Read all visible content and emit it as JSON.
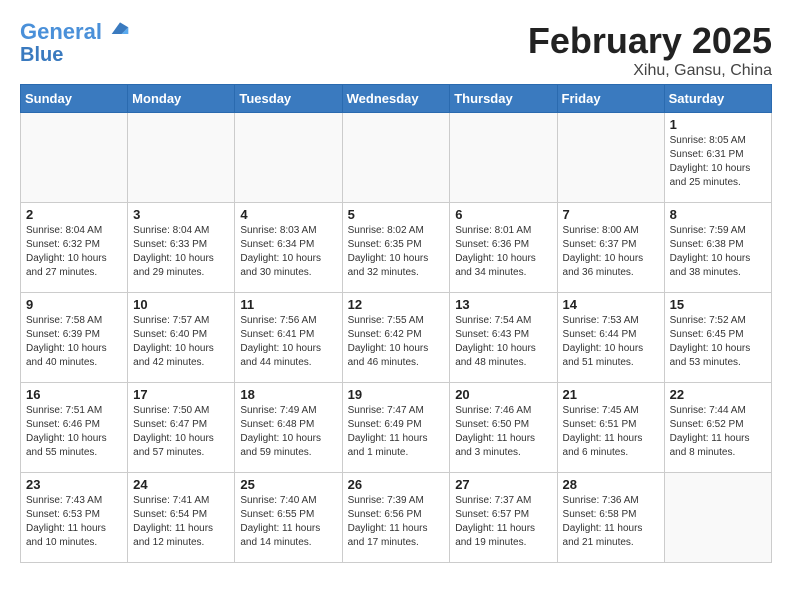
{
  "header": {
    "logo_line1": "General",
    "logo_line2": "Blue",
    "month": "February 2025",
    "location": "Xihu, Gansu, China"
  },
  "weekdays": [
    "Sunday",
    "Monday",
    "Tuesday",
    "Wednesday",
    "Thursday",
    "Friday",
    "Saturday"
  ],
  "weeks": [
    [
      {
        "day": "",
        "info": ""
      },
      {
        "day": "",
        "info": ""
      },
      {
        "day": "",
        "info": ""
      },
      {
        "day": "",
        "info": ""
      },
      {
        "day": "",
        "info": ""
      },
      {
        "day": "",
        "info": ""
      },
      {
        "day": "1",
        "info": "Sunrise: 8:05 AM\nSunset: 6:31 PM\nDaylight: 10 hours\nand 25 minutes."
      }
    ],
    [
      {
        "day": "2",
        "info": "Sunrise: 8:04 AM\nSunset: 6:32 PM\nDaylight: 10 hours\nand 27 minutes."
      },
      {
        "day": "3",
        "info": "Sunrise: 8:04 AM\nSunset: 6:33 PM\nDaylight: 10 hours\nand 29 minutes."
      },
      {
        "day": "4",
        "info": "Sunrise: 8:03 AM\nSunset: 6:34 PM\nDaylight: 10 hours\nand 30 minutes."
      },
      {
        "day": "5",
        "info": "Sunrise: 8:02 AM\nSunset: 6:35 PM\nDaylight: 10 hours\nand 32 minutes."
      },
      {
        "day": "6",
        "info": "Sunrise: 8:01 AM\nSunset: 6:36 PM\nDaylight: 10 hours\nand 34 minutes."
      },
      {
        "day": "7",
        "info": "Sunrise: 8:00 AM\nSunset: 6:37 PM\nDaylight: 10 hours\nand 36 minutes."
      },
      {
        "day": "8",
        "info": "Sunrise: 7:59 AM\nSunset: 6:38 PM\nDaylight: 10 hours\nand 38 minutes."
      }
    ],
    [
      {
        "day": "9",
        "info": "Sunrise: 7:58 AM\nSunset: 6:39 PM\nDaylight: 10 hours\nand 40 minutes."
      },
      {
        "day": "10",
        "info": "Sunrise: 7:57 AM\nSunset: 6:40 PM\nDaylight: 10 hours\nand 42 minutes."
      },
      {
        "day": "11",
        "info": "Sunrise: 7:56 AM\nSunset: 6:41 PM\nDaylight: 10 hours\nand 44 minutes."
      },
      {
        "day": "12",
        "info": "Sunrise: 7:55 AM\nSunset: 6:42 PM\nDaylight: 10 hours\nand 46 minutes."
      },
      {
        "day": "13",
        "info": "Sunrise: 7:54 AM\nSunset: 6:43 PM\nDaylight: 10 hours\nand 48 minutes."
      },
      {
        "day": "14",
        "info": "Sunrise: 7:53 AM\nSunset: 6:44 PM\nDaylight: 10 hours\nand 51 minutes."
      },
      {
        "day": "15",
        "info": "Sunrise: 7:52 AM\nSunset: 6:45 PM\nDaylight: 10 hours\nand 53 minutes."
      }
    ],
    [
      {
        "day": "16",
        "info": "Sunrise: 7:51 AM\nSunset: 6:46 PM\nDaylight: 10 hours\nand 55 minutes."
      },
      {
        "day": "17",
        "info": "Sunrise: 7:50 AM\nSunset: 6:47 PM\nDaylight: 10 hours\nand 57 minutes."
      },
      {
        "day": "18",
        "info": "Sunrise: 7:49 AM\nSunset: 6:48 PM\nDaylight: 10 hours\nand 59 minutes."
      },
      {
        "day": "19",
        "info": "Sunrise: 7:47 AM\nSunset: 6:49 PM\nDaylight: 11 hours\nand 1 minute."
      },
      {
        "day": "20",
        "info": "Sunrise: 7:46 AM\nSunset: 6:50 PM\nDaylight: 11 hours\nand 3 minutes."
      },
      {
        "day": "21",
        "info": "Sunrise: 7:45 AM\nSunset: 6:51 PM\nDaylight: 11 hours\nand 6 minutes."
      },
      {
        "day": "22",
        "info": "Sunrise: 7:44 AM\nSunset: 6:52 PM\nDaylight: 11 hours\nand 8 minutes."
      }
    ],
    [
      {
        "day": "23",
        "info": "Sunrise: 7:43 AM\nSunset: 6:53 PM\nDaylight: 11 hours\nand 10 minutes."
      },
      {
        "day": "24",
        "info": "Sunrise: 7:41 AM\nSunset: 6:54 PM\nDaylight: 11 hours\nand 12 minutes."
      },
      {
        "day": "25",
        "info": "Sunrise: 7:40 AM\nSunset: 6:55 PM\nDaylight: 11 hours\nand 14 minutes."
      },
      {
        "day": "26",
        "info": "Sunrise: 7:39 AM\nSunset: 6:56 PM\nDaylight: 11 hours\nand 17 minutes."
      },
      {
        "day": "27",
        "info": "Sunrise: 7:37 AM\nSunset: 6:57 PM\nDaylight: 11 hours\nand 19 minutes."
      },
      {
        "day": "28",
        "info": "Sunrise: 7:36 AM\nSunset: 6:58 PM\nDaylight: 11 hours\nand 21 minutes."
      },
      {
        "day": "",
        "info": ""
      }
    ]
  ]
}
